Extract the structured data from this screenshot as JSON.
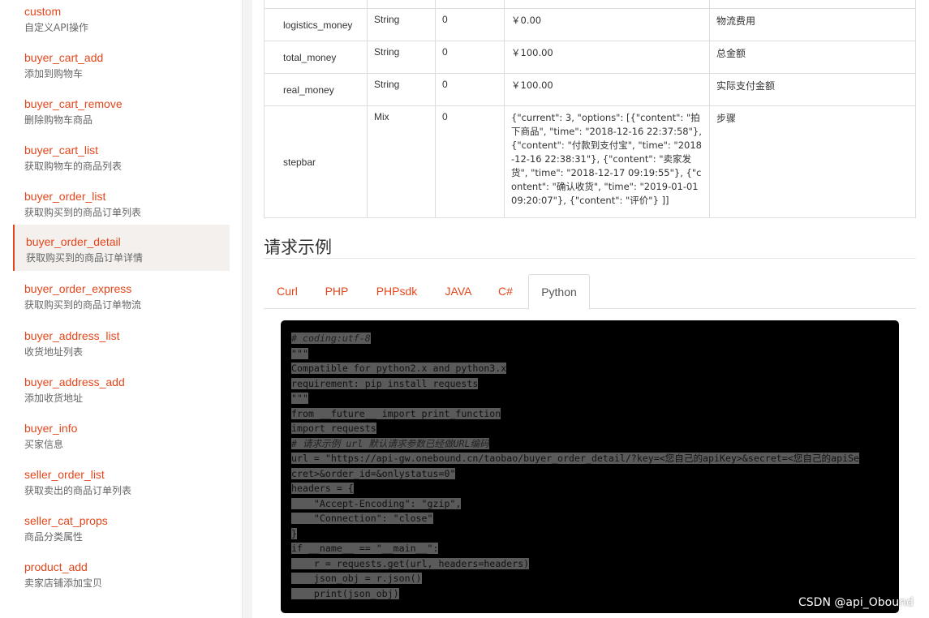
{
  "sidebar": {
    "items": [
      {
        "api": "custom",
        "desc": "自定义API操作"
      },
      {
        "api": "buyer_cart_add",
        "desc": "添加到购物车"
      },
      {
        "api": "buyer_cart_remove",
        "desc": "删除购物车商品"
      },
      {
        "api": "buyer_cart_list",
        "desc": "获取购物车的商品列表"
      },
      {
        "api": "buyer_order_list",
        "desc": "获取购买到的商品订单列表"
      },
      {
        "api": "buyer_order_detail",
        "desc": "获取购买到的商品订单详情"
      },
      {
        "api": "buyer_order_express",
        "desc": "获取购买到的商品订单物流"
      },
      {
        "api": "buyer_address_list",
        "desc": "收货地址列表"
      },
      {
        "api": "buyer_address_add",
        "desc": "添加收货地址"
      },
      {
        "api": "buyer_info",
        "desc": "买家信息"
      },
      {
        "api": "seller_order_list",
        "desc": "获取卖出的商品订单列表"
      },
      {
        "api": "seller_cat_props",
        "desc": "商品分类属性"
      },
      {
        "api": "product_add",
        "desc": "卖家店铺添加宝贝"
      }
    ],
    "active_index": 5
  },
  "params": {
    "rows": [
      {
        "name": "logistics_money",
        "type": "String",
        "required": "0",
        "example": "￥0.00",
        "desc": "物流费用"
      },
      {
        "name": "total_money",
        "type": "String",
        "required": "0",
        "example": "￥100.00",
        "desc": "总金额"
      },
      {
        "name": "real_money",
        "type": "String",
        "required": "0",
        "example": "￥100.00",
        "desc": "实际支付金额"
      },
      {
        "name": "stepbar",
        "type": "Mix",
        "required": "0",
        "example": "{\"current\": 3, \"options\": [{\"content\": \"拍下商品\", \"time\": \"2018-12-16 22:37:58\"}, {\"content\": \"付款到支付宝\", \"time\": \"2018-12-16 22:38:31\"}, {\"content\": \"卖家发货\", \"time\": \"2018-12-17 09:19:55\"}, {\"content\": \"确认收货\", \"time\": \"2019-01-01 09:20:07\"}, {\"content\": \"评价\"} ]]",
        "desc": "步骤"
      }
    ]
  },
  "request_example": {
    "title": "请求示例",
    "tabs": [
      "Curl",
      "PHP",
      "PHPsdk",
      "JAVA",
      "C#",
      "Python"
    ],
    "active_tab": "Python",
    "code_lines": [
      "# coding:utf-8",
      "\"\"\"",
      "Compatible for python2.x and python3.x",
      "requirement: pip install requests",
      "\"\"\"",
      "from __future__ import print_function",
      "import requests",
      "# 请求示例 url 默认请求参数已经做URL编码",
      "url = \"https://api-gw.onebound.cn/taobao/buyer_order_detail/?key=<您自己的apiKey>&secret=<您自己的apiSe",
      "cret>&order_id=&onlystatus=0\"",
      "headers = {",
      "    \"Accept-Encoding\": \"gzip\",",
      "    \"Connection\": \"close\"",
      "}",
      "if __name__ == \"__main__\":",
      "    r = requests.get(url, headers=headers)",
      "    json_obj = r.json()",
      "    print(json_obj)"
    ]
  },
  "watermark": "CSDN @api_Obound",
  "colors": {
    "accent": "#e4461b",
    "code_bg": "#000000",
    "active_bg": "#f3f0ee"
  }
}
